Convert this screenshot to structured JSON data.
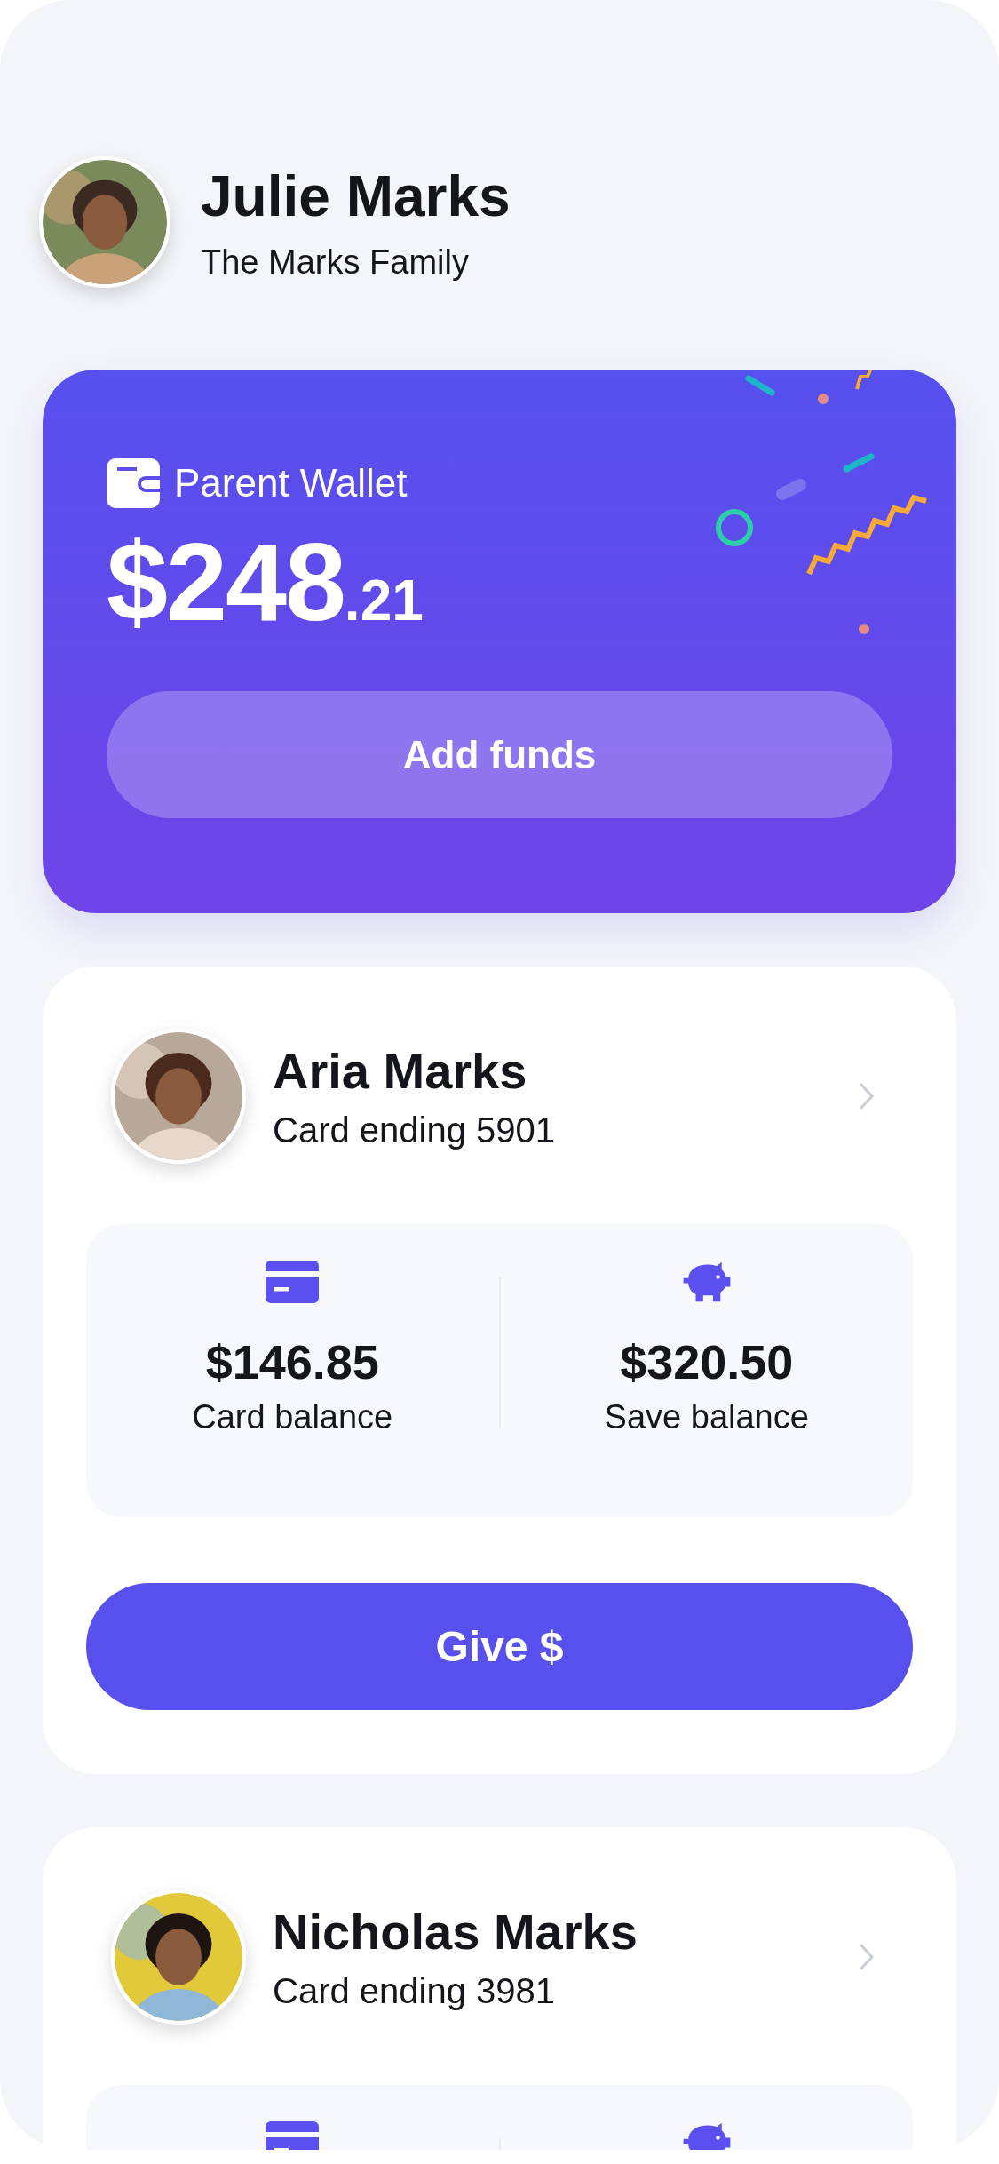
{
  "profile": {
    "name": "Julie Marks",
    "subtitle": "The Marks Family"
  },
  "wallet": {
    "label": "Parent Wallet",
    "amount": "$248",
    "cents": ".21",
    "button": "Add funds"
  },
  "children": [
    {
      "name": "Aria Marks",
      "card": "Card ending 5901",
      "balances": [
        {
          "kind": "card",
          "amount": "$146.85",
          "label": "Card balance"
        },
        {
          "kind": "save",
          "amount": "$320.50",
          "label": "Save balance"
        }
      ],
      "button": "Give $"
    },
    {
      "name": "Nicholas Marks",
      "card": "Card ending 3981",
      "balances": [
        {
          "kind": "card"
        },
        {
          "kind": "save"
        }
      ]
    }
  ]
}
